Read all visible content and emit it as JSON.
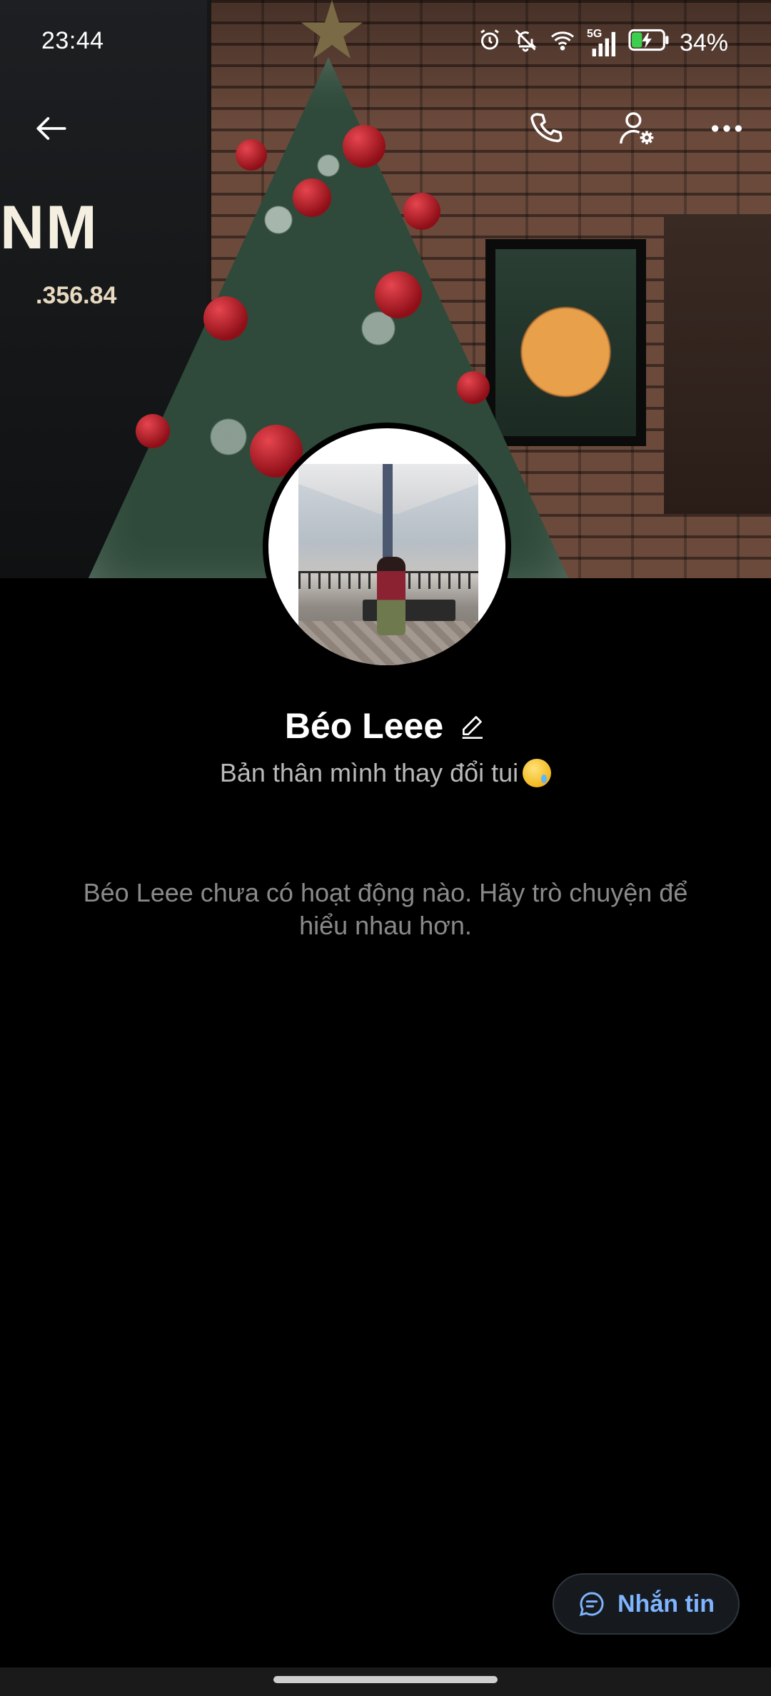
{
  "status_bar": {
    "time": "23:44",
    "network": "5G",
    "battery_percent": "34%",
    "battery_level": 0.34,
    "icons": [
      "alarm-icon",
      "mute-icon",
      "wifi-icon",
      "signal-icon",
      "battery-charging-icon"
    ]
  },
  "cover": {
    "sign_text": "NM",
    "phone_text": ".356.84"
  },
  "top_bar": {
    "icons": [
      "back-arrow-icon",
      "phone-call-icon",
      "profile-settings-icon",
      "more-options-icon"
    ]
  },
  "profile": {
    "name": "Béo Leee",
    "status": "Bản thân mình thay đổi tui",
    "status_emoji_icon": "crying-smile-emoji-icon"
  },
  "feed": {
    "empty_message": "Béo Leee chưa có hoạt động nào. Hãy trò chuyện để hiểu nhau hơn."
  },
  "fab": {
    "label": "Nhắn tin",
    "icon": "chat-bubble-icon"
  },
  "colors": {
    "background": "#000000",
    "accent": "#7fb4ff",
    "secondary_text": "#b9b9b9",
    "muted_text": "#8a8a8a"
  }
}
